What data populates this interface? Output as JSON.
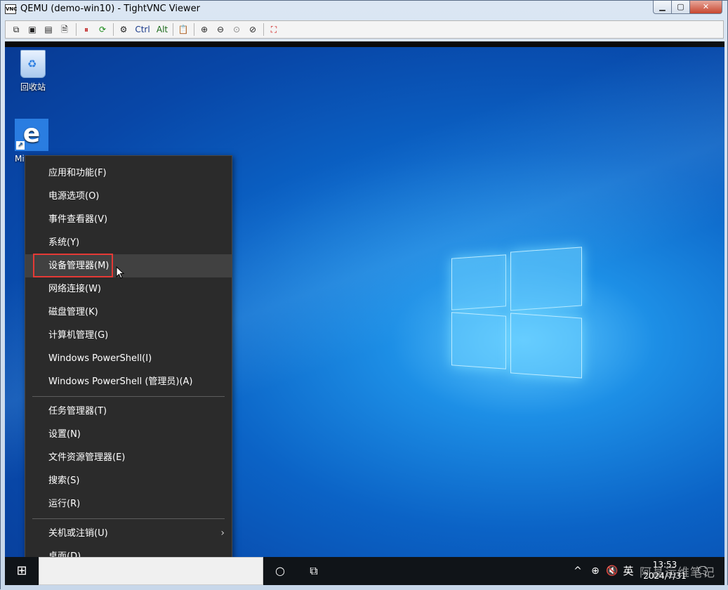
{
  "window": {
    "app_icon_text": "VNC",
    "title": "QEMU (demo-win10) - TightVNC Viewer",
    "min_icon": "minimize-icon",
    "max_icon": "maximize-icon",
    "close_icon": "close-icon",
    "min_glyph": "▁",
    "max_glyph": "▢",
    "close_glyph": "✕"
  },
  "toolbar": {
    "buttons": [
      {
        "name": "new-connection-icon",
        "glyph": "⧉"
      },
      {
        "name": "save-icon",
        "glyph": "▣"
      },
      {
        "name": "options-icon",
        "glyph": "▤"
      },
      {
        "name": "info-icon",
        "glyph": "🗎"
      },
      {
        "name": "pause-icon",
        "glyph": "⏸"
      },
      {
        "name": "refresh-icon",
        "glyph": "⟳"
      },
      {
        "name": "ctrl-alt-del-icon",
        "glyph": "⚙"
      },
      {
        "name": "clipboard-icon",
        "glyph": "📋"
      },
      {
        "name": "zoom-in-icon",
        "glyph": "⊕"
      },
      {
        "name": "zoom-out-icon",
        "glyph": "⊖"
      },
      {
        "name": "zoom-reset-icon",
        "glyph": "⊙"
      },
      {
        "name": "zoom-fit-icon",
        "glyph": "⊘"
      },
      {
        "name": "fullscreen-icon",
        "glyph": "⛶"
      }
    ],
    "ctrl_label": "Ctrl",
    "alt_label": "Alt"
  },
  "desktop": {
    "recycle_bin_label": "回收站",
    "recycle_glyph": "♻",
    "edge_glyph": "e",
    "shortcut_glyph": "↗",
    "edge_label": "Mi"
  },
  "context_menu": {
    "items": [
      {
        "label": "应用和功能(F)"
      },
      {
        "label": "电源选项(O)"
      },
      {
        "label": "事件查看器(V)"
      },
      {
        "label": "系统(Y)"
      },
      {
        "label": "设备管理器(M)"
      },
      {
        "label": "网络连接(W)"
      },
      {
        "label": "磁盘管理(K)"
      },
      {
        "label": "计算机管理(G)"
      },
      {
        "label": "Windows PowerShell(I)"
      },
      {
        "label": "Windows PowerShell (管理员)(A)"
      },
      {
        "label": "任务管理器(T)"
      },
      {
        "label": "设置(N)"
      },
      {
        "label": "文件资源管理器(E)"
      },
      {
        "label": "搜索(S)"
      },
      {
        "label": "运行(R)"
      },
      {
        "label": "关机或注销(U)"
      },
      {
        "label": "桌面(D)"
      }
    ],
    "submenu_arrow": "›"
  },
  "taskbar": {
    "start_glyph": "⊞",
    "cortana_glyph": "○",
    "taskview_glyph": "⧉",
    "tray_up_glyph": "^",
    "network_glyph": "⊕",
    "volume_glyph": "🔇",
    "ime_label": "英",
    "time": "13:53",
    "date": "2024/7/31",
    "notif_glyph": "🗨",
    "watermark": "阿晶运维笔记"
  }
}
